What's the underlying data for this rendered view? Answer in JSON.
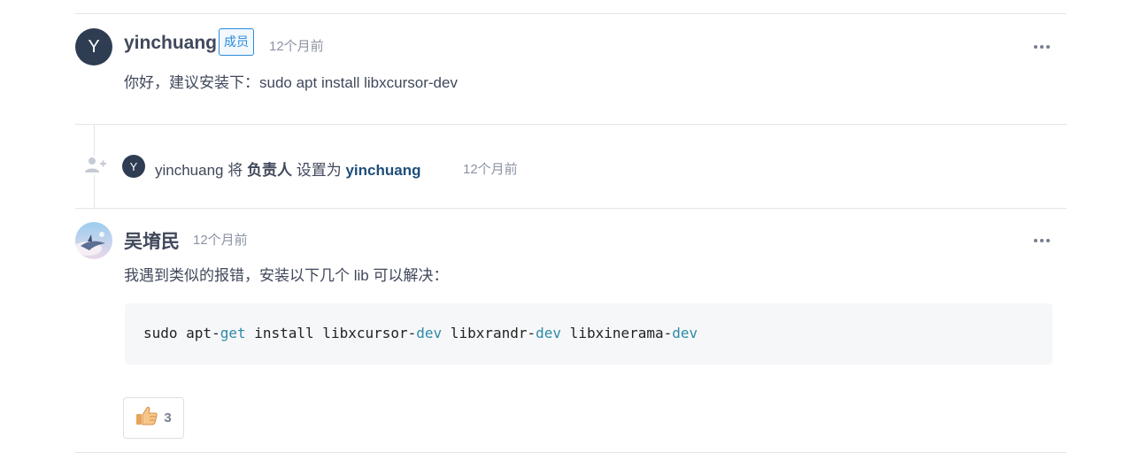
{
  "comment1": {
    "avatar_letter": "Y",
    "author": "yinchuang",
    "badge": "成员",
    "time": "12个月前",
    "body": "你好，建议安装下：sudo apt install libxcursor-dev"
  },
  "event": {
    "avatar_letter": "Y",
    "actor": "yinchuang",
    "verb1": "将",
    "field": "负责人",
    "verb2": "设置为",
    "target": "yinchuang",
    "time": "12个月前"
  },
  "comment2": {
    "author": "吴堉民",
    "time": "12个月前",
    "body": "我遇到类似的报错，安装以下几个 lib 可以解决：",
    "code": {
      "parts": [
        "sudo apt-",
        "get",
        " install libxcursor-",
        "dev",
        " libxrandr-",
        "dev",
        " libxinerama-",
        "dev"
      ]
    },
    "reaction": {
      "icon": "thumbs-up-icon",
      "count": "3"
    }
  },
  "colors": {
    "accent": "#2b8ad8",
    "avatar_bg": "#2e3d52",
    "code_keyword": "#2c8aa8",
    "link": "#1e4e7a"
  }
}
